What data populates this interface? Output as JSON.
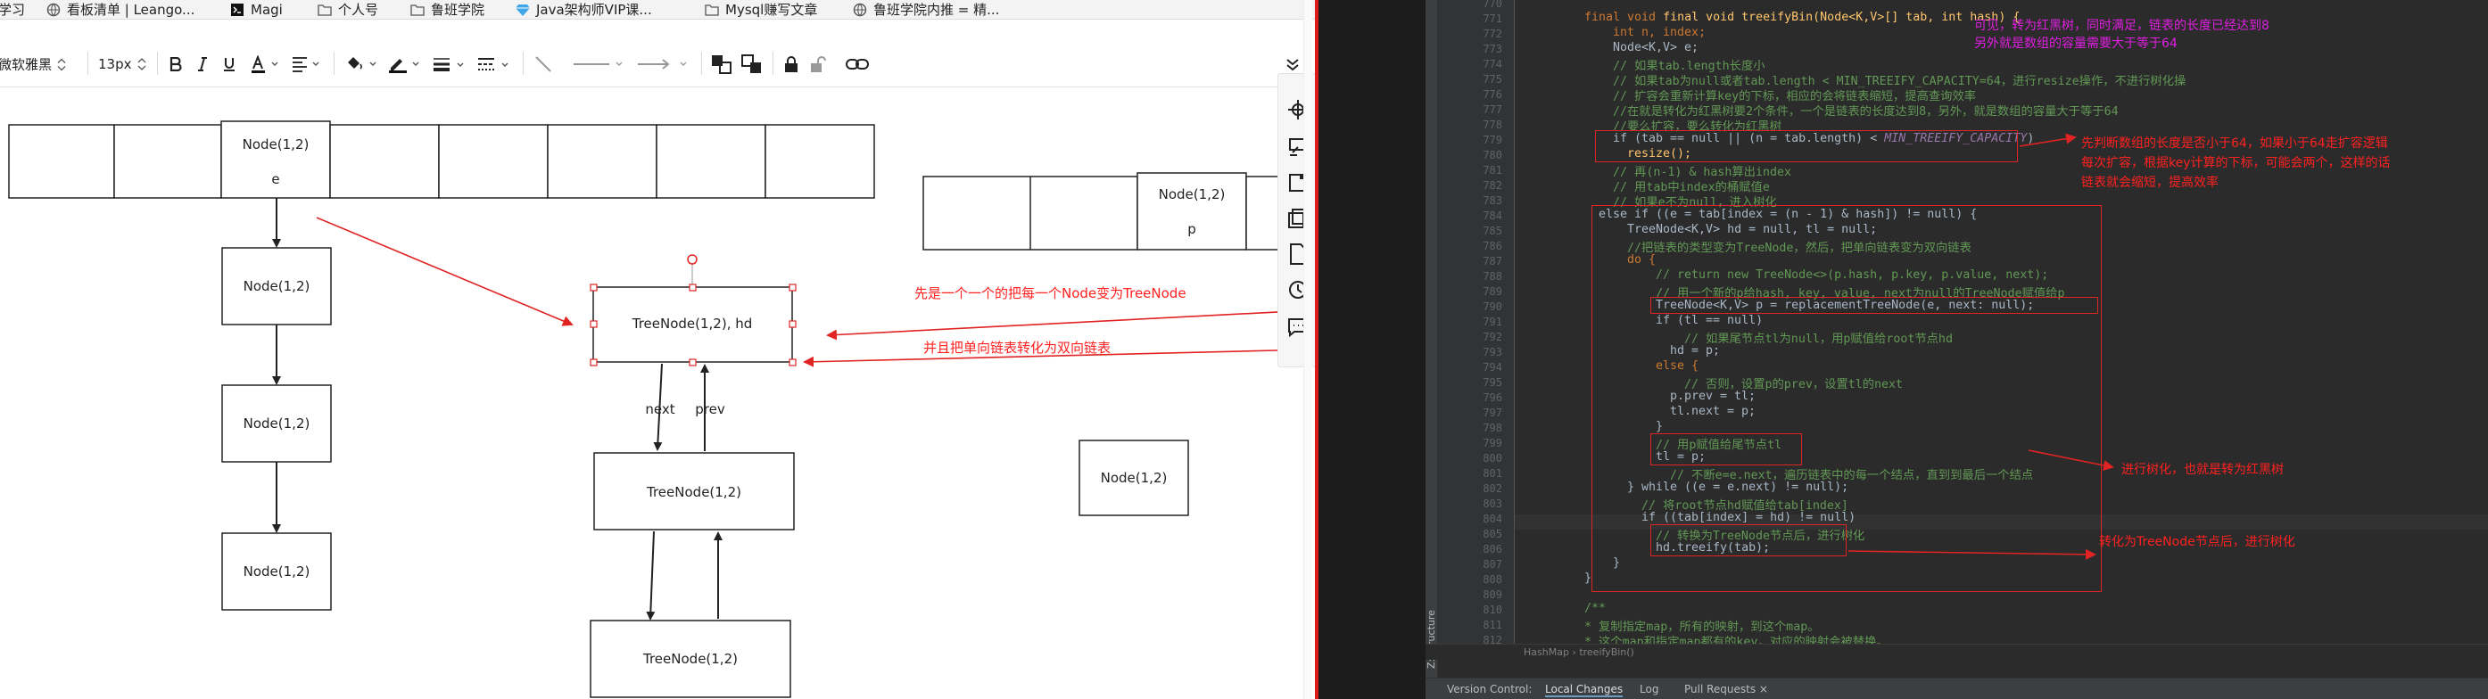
{
  "bookmarks": [
    {
      "label": "学习",
      "icon": "folder-icon"
    },
    {
      "label": "看板清单 | Leango...",
      "icon": "globe-icon"
    },
    {
      "label": "Magi",
      "icon": "magi-icon"
    },
    {
      "label": "个人号",
      "icon": "folder-icon"
    },
    {
      "label": "鲁班学院",
      "icon": "folder-icon"
    },
    {
      "label": "Java架构师VIP课...",
      "icon": "gem-icon"
    },
    {
      "label": "Mysql赚写文章",
      "icon": "folder-icon"
    },
    {
      "label": "鲁班学院内推 = 精...",
      "icon": "globe-icon"
    }
  ],
  "toolbar": {
    "font_family": "微软雅黑",
    "font_size": "13px"
  },
  "diagram": {
    "top_array": {
      "label": "Node(1,2)",
      "sublabel": "e"
    },
    "chain": [
      "Node(1,2)",
      "Node(1,2)",
      "Node(1,2)"
    ],
    "second_array": {
      "label": "Node(1,2)",
      "sublabel": "p"
    },
    "tree_head": "TreeNode(1,2),    hd",
    "tree_nodes": [
      "TreeNode(1,2)",
      "TreeNode(1,2)"
    ],
    "next_label": "next",
    "prev_label": "prev",
    "standalone_node": "Node(1,2)",
    "annotation_1": "先是一个一个的把每一个Node变为TreeNode",
    "annotation_2": "并且把单向链表转化为双向链表",
    "colors": {
      "arrow": "#e02424",
      "annotation": "#ff2020"
    }
  },
  "ide": {
    "line_numbers": [
      "770",
      "771",
      "772",
      "773",
      "774",
      "775",
      "776",
      "777",
      "778",
      "779",
      "780",
      "781",
      "782",
      "783",
      "784",
      "785",
      "786",
      "787",
      "788",
      "789",
      "790",
      "791",
      "792",
      "793",
      "794",
      "795",
      "796",
      "797",
      "798",
      "799",
      "800",
      "801",
      "802",
      "803",
      "804",
      "805",
      "806",
      "807",
      "808",
      "809",
      "810",
      "811",
      "812"
    ],
    "code": {
      "l771": "final void treeifyBin(Node<K,V>[] tab, int hash) {",
      "l772": "int n, index;",
      "l773": "Node<K,V> e;",
      "l774": "// 如果tab.length长度小",
      "l775": "// 如果tab为null或者tab.length < MIN_TREEIFY_CAPACITY=64，进行resize操作，不进行树化操",
      "l776": "// 扩容会重新计算key的下标，相应的会将链表缩短，提高查询效率",
      "l777": "//在就是转化为红黑树要2个条件，一个是链表的长度达到8，另外，就是数组的容量大于等于64",
      "l778": "//要么扩容，要么转化为红黑树",
      "l779a": "if (tab == null || (n = tab.length) < ",
      "l779b": "MIN_TREEIFY_CAPACITY",
      "l779c": ")",
      "l780": "resize();",
      "l781": "// 再(n-1) & hash算出index",
      "l782": "// 用tab中index的桶赋值e",
      "l783": "// 如果e不为null，进入树化",
      "l784": "else if ((e = tab[index = (n - 1) & hash]) != null) {",
      "l785": "TreeNode<K,V> hd = null, tl = null;",
      "l786": "//把链表的类型变为TreeNode，然后，把单向链表变为双向链表",
      "l787": "do {",
      "l788": "// return new TreeNode<>(p.hash, p.key, p.value, next);",
      "l789": "// 用一个新的p给hash, key, value, next为null的TreeNode赋值给p",
      "l790": "TreeNode<K,V> p = replacementTreeNode(e, next: null);",
      "l791": "if (tl == null)",
      "l792": "// 如果尾节点tl为null，用p赋值给root节点hd",
      "l793": "hd = p;",
      "l794": "else {",
      "l795": "// 否则，设置p的prev，设置tl的next",
      "l796": "p.prev = tl;",
      "l797": "tl.next = p;",
      "l798": "}",
      "l799": "// 用p赋值给尾节点tl",
      "l800": "tl = p;",
      "l801": "// 不断e=e.next，遍历链表中的每一个结点，直到到最后一个结点",
      "l802": "} while ((e = e.next) != null);",
      "l803": "// 将root节点hd赋值给tab[index]",
      "l804": "if ((tab[index] = hd) != null)",
      "l805": "// 转换为TreeNode节点后，进行树化",
      "l806": "hd.treeify(tab);",
      "l807": "}",
      "l808": "}",
      "l809": "",
      "l810": "/**",
      "l811": "* 复制指定map，所有的映射，到这个map。",
      "l812": "* 这个map和指定map都有的key，对应的映射会被替换。"
    },
    "annotations": {
      "top_purple_1": "可见，转为红黑树，同时满足，链表的长度已经达到8",
      "top_purple_2": "另外就是数组的容量需要大于等于64",
      "resize_1": "先判断数组的长度是否小于64，如果小于64走扩容逻辑",
      "resize_2": "每次扩容，根据key计算的下标，可能会两个，这样的话",
      "resize_3": "链表就会缩短，提高效率",
      "treeify": "进行树化，也就是转为红黑树",
      "after_treenode": "转化为TreeNode节点后，进行树化"
    },
    "breadcrumb": "HashMap  ›  treeifyBin()",
    "structure_label": "Z: Structure",
    "bottom_tabs": [
      "Version Control:",
      "Local Changes",
      "Log",
      "Pull Requests ×"
    ]
  }
}
